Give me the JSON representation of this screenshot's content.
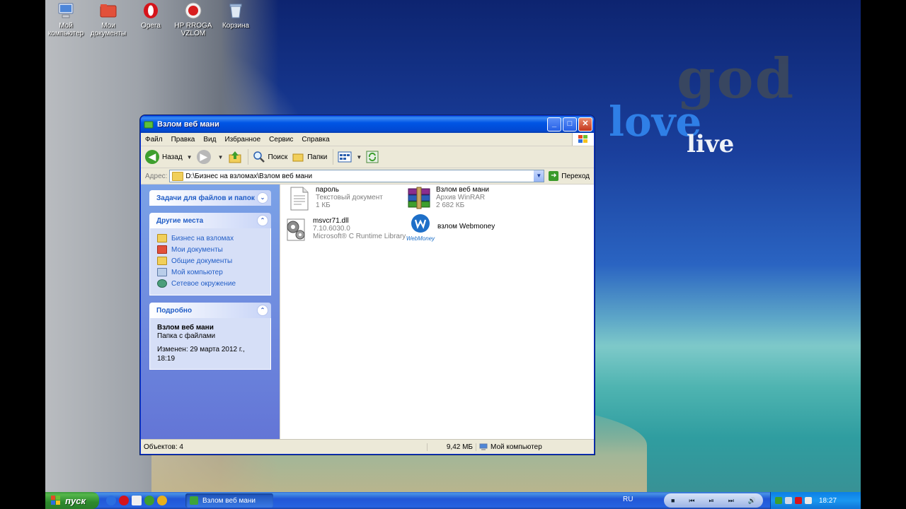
{
  "desktop": {
    "icons": [
      {
        "label": "Мой компьютер",
        "name": "my-computer"
      },
      {
        "label": "Мои документы",
        "name": "my-documents"
      },
      {
        "label": "Opera",
        "name": "opera"
      },
      {
        "label": "HP RROGA VZLOM",
        "name": "hp-rroga-vzlom"
      },
      {
        "label": "Корзина",
        "name": "recycle-bin"
      }
    ],
    "wallpaper_text": {
      "god": "god",
      "love": "love",
      "live": "live"
    }
  },
  "window": {
    "title": "Взлом веб мани",
    "menu": [
      "Файл",
      "Правка",
      "Вид",
      "Избранное",
      "Сервис",
      "Справка"
    ],
    "toolbar": {
      "back": "Назад",
      "search": "Поиск",
      "folders": "Папки"
    },
    "address": {
      "label": "Адрес:",
      "value": "D:\\Бизнес на взломах\\Взлом веб мани",
      "go": "Переход"
    },
    "tasks": {
      "file_tasks_title": "Задачи для файлов и папок",
      "other_places_title": "Другие места",
      "other_places": [
        {
          "label": "Бизнес на взломах",
          "icon": "folder-icon"
        },
        {
          "label": "Мои документы",
          "icon": "my-documents-icon"
        },
        {
          "label": "Общие документы",
          "icon": "folder-icon"
        },
        {
          "label": "Мой компьютер",
          "icon": "computer-icon"
        },
        {
          "label": "Сетевое окружение",
          "icon": "network-icon"
        }
      ],
      "details_title": "Подробно",
      "details": {
        "name": "Взлом веб мани",
        "type": "Папка с файлами",
        "modified": "Изменен: 29 марта 2012 г., 18:19"
      }
    },
    "files": [
      {
        "name": "пароль",
        "line2": "Текстовый документ",
        "line3": "1 КБ",
        "icon": "text-document-icon"
      },
      {
        "name": "Взлом веб мани",
        "line2": "Архив WinRAR",
        "line3": "2 682 КБ",
        "icon": "winrar-archive-icon"
      },
      {
        "name": "msvcr71.dll",
        "line2": "7.10.6030.0",
        "line3": "Microsoft® C Runtime Library",
        "icon": "dll-gears-icon"
      },
      {
        "name": "взлом Webmoney",
        "line2": "",
        "line3": "",
        "icon": "webmoney-icon",
        "icon_caption": "WebMoney"
      }
    ],
    "status": {
      "objects": "Объектов: 4",
      "size": "9,42 МБ",
      "location": "Мой компьютер"
    }
  },
  "taskbar": {
    "start": "пуск",
    "task_button": "Взлом веб мани",
    "lang": "RU",
    "clock": "18:27"
  },
  "colors": {
    "xp_blue": "#0055e5",
    "start_green": "#2c8a2c",
    "link_blue": "#215dc6"
  }
}
